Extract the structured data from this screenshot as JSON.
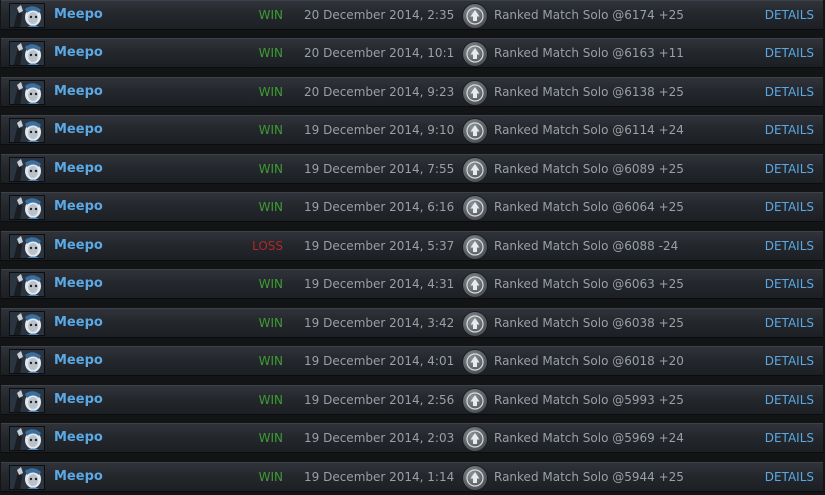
{
  "colors": {
    "hero_name": "#5aa9e6",
    "win": "#3f9c34",
    "loss": "#b0282a",
    "muted_text": "#9aa0a6",
    "details_link": "#5aa9e6",
    "row_background": "#25282d"
  },
  "icons": {
    "hero_portrait": "meepo-hero-portrait",
    "game_mode": "ranked-mode-icon"
  },
  "matches": [
    {
      "hero": "Meepo",
      "result": "WIN",
      "outcome": "win",
      "date": "20 December 2014, 2:35",
      "mode": "Ranked Match Solo @6174 +25",
      "details": "DETAILS"
    },
    {
      "hero": "Meepo",
      "result": "WIN",
      "outcome": "win",
      "date": "20 December 2014, 10:1",
      "mode": "Ranked Match Solo @6163 +11",
      "details": "DETAILS"
    },
    {
      "hero": "Meepo",
      "result": "WIN",
      "outcome": "win",
      "date": "20 December 2014, 9:23",
      "mode": "Ranked Match Solo @6138 +25",
      "details": "DETAILS"
    },
    {
      "hero": "Meepo",
      "result": "WIN",
      "outcome": "win",
      "date": "19 December 2014, 9:10",
      "mode": "Ranked Match Solo @6114 +24",
      "details": "DETAILS"
    },
    {
      "hero": "Meepo",
      "result": "WIN",
      "outcome": "win",
      "date": "19 December 2014, 7:55",
      "mode": "Ranked Match Solo @6089 +25",
      "details": "DETAILS"
    },
    {
      "hero": "Meepo",
      "result": "WIN",
      "outcome": "win",
      "date": "19 December 2014, 6:16",
      "mode": "Ranked Match Solo @6064 +25",
      "details": "DETAILS"
    },
    {
      "hero": "Meepo",
      "result": "LOSS",
      "outcome": "loss",
      "date": "19 December 2014, 5:37",
      "mode": "Ranked Match Solo @6088 -24",
      "details": "DETAILS"
    },
    {
      "hero": "Meepo",
      "result": "WIN",
      "outcome": "win",
      "date": "19 December 2014, 4:31",
      "mode": "Ranked Match Solo @6063 +25",
      "details": "DETAILS"
    },
    {
      "hero": "Meepo",
      "result": "WIN",
      "outcome": "win",
      "date": "19 December 2014, 3:42",
      "mode": "Ranked Match Solo @6038 +25",
      "details": "DETAILS"
    },
    {
      "hero": "Meepo",
      "result": "WIN",
      "outcome": "win",
      "date": "19 December 2014, 4:01",
      "mode": "Ranked Match Solo @6018 +20",
      "details": "DETAILS"
    },
    {
      "hero": "Meepo",
      "result": "WIN",
      "outcome": "win",
      "date": "19 December 2014, 2:56",
      "mode": "Ranked Match Solo @5993 +25",
      "details": "DETAILS"
    },
    {
      "hero": "Meepo",
      "result": "WIN",
      "outcome": "win",
      "date": "19 December 2014, 2:03",
      "mode": "Ranked Match Solo @5969 +24",
      "details": "DETAILS"
    },
    {
      "hero": "Meepo",
      "result": "WIN",
      "outcome": "win",
      "date": "19 December 2014, 1:14",
      "mode": "Ranked Match Solo @5944 +25",
      "details": "DETAILS"
    }
  ]
}
